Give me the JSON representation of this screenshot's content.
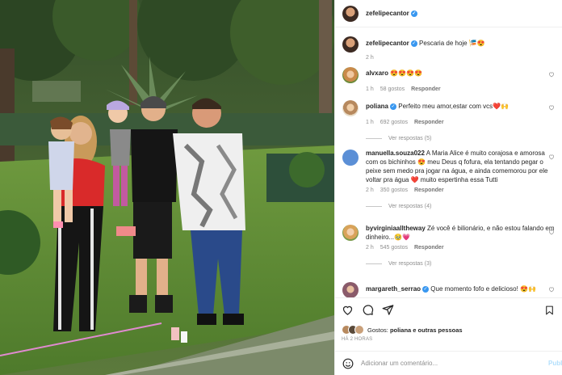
{
  "post": {
    "author": "zefelipecantor",
    "caption_author": "zefelipecantor",
    "caption_text": "Pescaria de hoje 🎏😍",
    "caption_time": "2 h"
  },
  "comments": [
    {
      "user": "alvxaro",
      "verified": false,
      "text": "😍😍😍😍",
      "time": "1 h",
      "likes": "58 gostos",
      "reply": "Responder",
      "replies": "",
      "avatar_color": "#c98a4a"
    },
    {
      "user": "poliana",
      "verified": true,
      "text": "Perfeito meu amor,estar com vcs❤️🙌",
      "time": "1 h",
      "likes": "692 gostos",
      "reply": "Responder",
      "replies": "Ver respostas (5)",
      "avatar_color": "#b7895e"
    },
    {
      "user": "manuella.souza022",
      "verified": false,
      "text": "A Maria Alice é muito corajosa e amorosa com os bichinhos 😍 meu Deus q fofura, ela tentando pegar o peixe sem medo pra jogar na água, e ainda comemorou por ele voltar pra água ❤️ muito espertinha essa Tutti",
      "time": "2 h",
      "likes": "350 gostos",
      "reply": "Responder",
      "replies": "Ver respostas (4)",
      "avatar_color": "#5b8fd6"
    },
    {
      "user": "byvirginiaalltheway",
      "verified": false,
      "text": "Zé você é bilionário, e não estou falando em dinheiro...🥹💗",
      "time": "2 h",
      "likes": "545 gostos",
      "reply": "Responder",
      "replies": "Ver respostas (3)",
      "avatar_color": "#d9a35a"
    },
    {
      "user": "margareth_serrao",
      "verified": true,
      "text": "Que momento fofo e delicioso! 😍🙌",
      "time": "",
      "likes": "",
      "reply": "",
      "replies": "",
      "avatar_color": "#8a5a6a"
    }
  ],
  "actions": {
    "likes_prefix": "Gostos:",
    "likes_names": "poliana e outras pessoas",
    "time_ago": "HÁ 2 HORAS",
    "comment_placeholder": "Adicionar um comentário...",
    "publish_label": "Publi"
  },
  "colors": {
    "verified": "#3897f0",
    "heart": "#ed4956",
    "muted": "#8e8e8e"
  }
}
